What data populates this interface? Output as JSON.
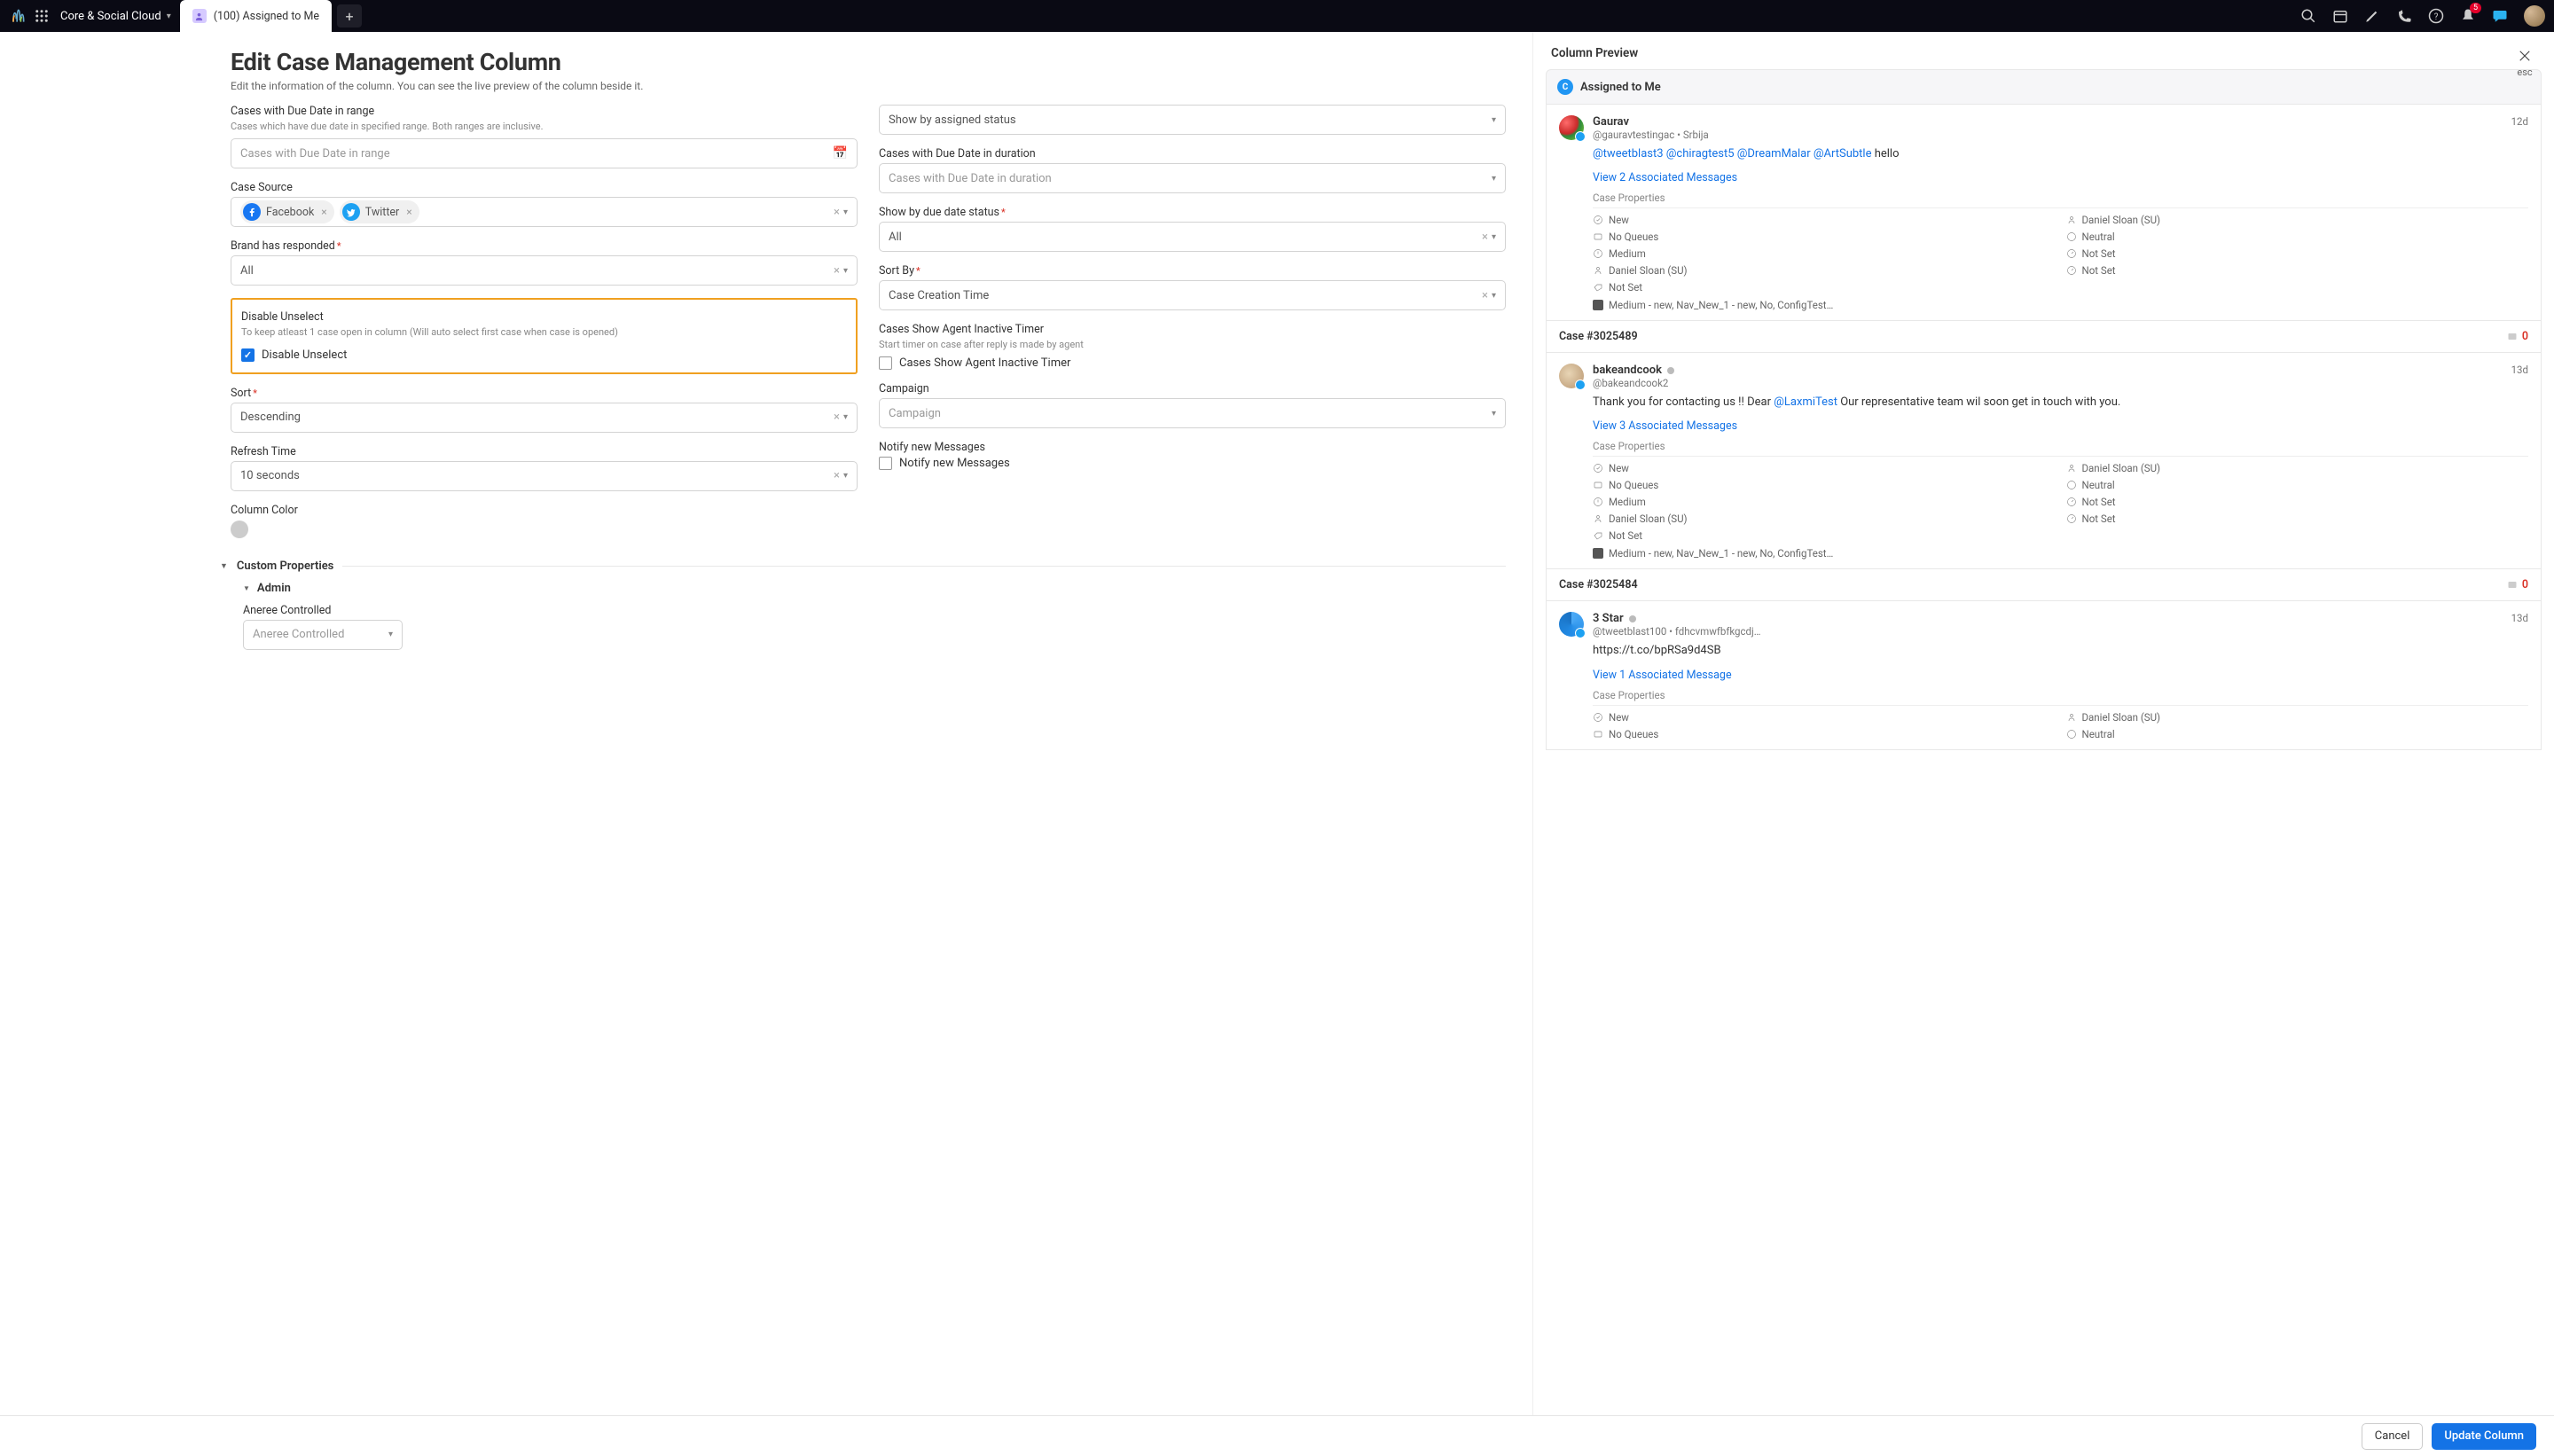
{
  "topbar": {
    "workspace": "Core & Social Cloud",
    "tab_label": "(100) Assigned to Me",
    "notif_count": "5"
  },
  "form": {
    "title": "Edit Case Management Column",
    "subtitle": "Edit the information of the column. You can see the live preview of the column beside it.",
    "due_range_label": "Cases with Due Date in range",
    "due_range_help": "Cases which have due date in specified range. Both ranges are inclusive.",
    "due_range_placeholder": "Cases with Due Date in range",
    "case_source_label": "Case Source",
    "source_chips": [
      "Facebook",
      "Twitter"
    ],
    "brand_responded_label": "Brand has responded",
    "brand_responded_value": "All",
    "disable_unselect_label": "Disable Unselect",
    "disable_unselect_help": "To keep atleast 1 case open in column (Will auto select first case when case is opened)",
    "disable_unselect_checkbox": "Disable Unselect",
    "sort_label": "Sort",
    "sort_value": "Descending",
    "refresh_label": "Refresh Time",
    "refresh_value": "10 seconds",
    "column_color_label": "Column Color",
    "show_assigned_value": "Show by assigned status",
    "due_duration_label": "Cases with Due Date in duration",
    "due_duration_placeholder": "Cases with Due Date in duration",
    "show_due_status_label": "Show by due date status",
    "show_due_status_value": "All",
    "sort_by_label": "Sort By",
    "sort_by_value": "Case Creation Time",
    "agent_timer_label": "Cases Show Agent Inactive Timer",
    "agent_timer_help": "Start timer on case after reply is made by agent",
    "agent_timer_checkbox": "Cases Show Agent Inactive Timer",
    "campaign_label": "Campaign",
    "campaign_placeholder": "Campaign",
    "notify_label": "Notify new Messages",
    "notify_checkbox": "Notify new Messages",
    "custom_props_label": "Custom Properties",
    "admin_label": "Admin",
    "aneree_label": "Aneree Controlled",
    "aneree_placeholder": "Aneree Controlled"
  },
  "preview": {
    "header": "Column Preview",
    "close_label": "esc",
    "col_title": "Assigned to Me",
    "cards": [
      {
        "name": "Gaurav",
        "handle": "@gauravtestingac • Srbija",
        "time": "12d",
        "body_pre": "",
        "mentions": "@tweetblast3 @chiragtest5 @DreamMalar @ArtSubtle",
        "body_post": " hello",
        "view_link": "View 2 Associated Messages",
        "props_label": "Case Properties",
        "props": {
          "p1": "New",
          "p2": "Daniel Sloan (SU)",
          "p3": "No Queues",
          "p4": "Neutral",
          "p5": "Medium",
          "p6": "Not Set",
          "p7": "Daniel Sloan (SU)",
          "p8": "Not Set",
          "p9": "Not Set"
        },
        "tags": "Medium - new, Nav_New_1 - new, No, ConfigTest…"
      },
      {
        "case_num": "Case #3025489",
        "case_count": "0",
        "name": "bakeandcook",
        "handle": "@bakeandcook2",
        "time": "13d",
        "body_pre": "Thank you for contacting us !! Dear ",
        "mentions": "@LaxmiTest",
        "body_post": " Our representative team wil soon get in touch with you.",
        "view_link": "View 3 Associated Messages",
        "props_label": "Case Properties",
        "props": {
          "p1": "New",
          "p2": "Daniel Sloan (SU)",
          "p3": "No Queues",
          "p4": "Neutral",
          "p5": "Medium",
          "p6": "Not Set",
          "p7": "Daniel Sloan (SU)",
          "p8": "Not Set",
          "p9": "Not Set"
        },
        "tags": "Medium - new, Nav_New_1 - new, No, ConfigTest…"
      },
      {
        "case_num": "Case #3025484",
        "case_count": "0",
        "name": "3 Star",
        "handle": "@tweetblast100 • fdhcvmwfbfkgcdj…",
        "time": "13d",
        "body_pre": "https://t.co/bpRSa9d4SB",
        "mentions": "",
        "body_post": "",
        "view_link": "View 1 Associated Message",
        "props_label": "Case Properties",
        "props": {
          "p1": "New",
          "p2": "Daniel Sloan (SU)",
          "p3": "No Queues",
          "p4": "Neutral"
        }
      }
    ]
  },
  "footer": {
    "cancel": "Cancel",
    "update": "Update Column"
  }
}
